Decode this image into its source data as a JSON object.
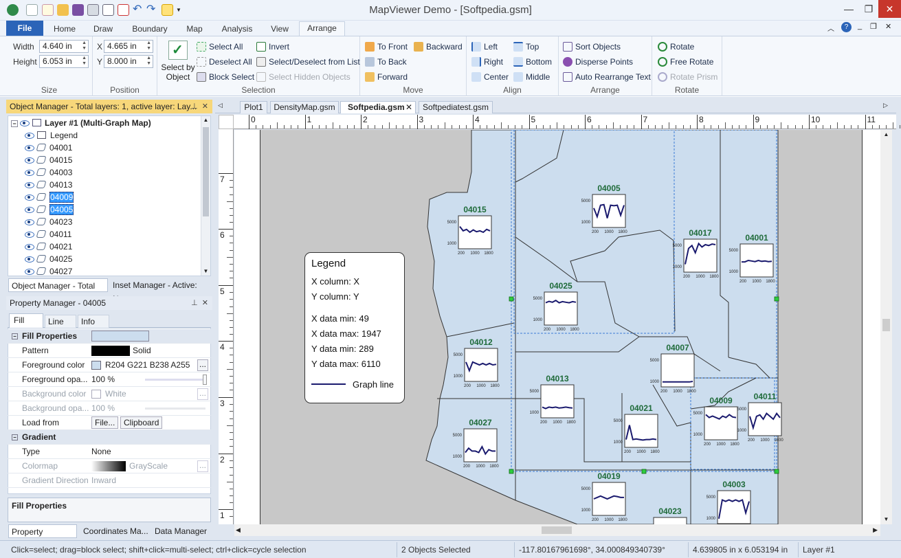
{
  "app": {
    "title": "MapViewer Demo - [Softpedia.gsm]"
  },
  "ribbon_tabs": [
    "File",
    "Home",
    "Draw",
    "Boundary",
    "Map",
    "Analysis",
    "View",
    "Arrange"
  ],
  "size": {
    "label": "Size",
    "width_label": "Width",
    "width": "4.640 in",
    "height_label": "Height",
    "height": "6.053 in"
  },
  "position": {
    "label": "Position",
    "x_label": "X",
    "x": "4.665 in",
    "y_label": "Y",
    "y": "8.000 in"
  },
  "selection": {
    "label": "Selection",
    "select_by_object": "Select by Object",
    "select_all": "Select All",
    "deselect_all": "Deselect All",
    "block_select": "Block Select",
    "invert": "Invert",
    "select_deselect_list": "Select/Deselect from List",
    "select_hidden": "Select Hidden Objects"
  },
  "move": {
    "label": "Move",
    "to_front": "To Front",
    "to_back": "To Back",
    "forward": "Forward",
    "backward": "Backward"
  },
  "align": {
    "label": "Align",
    "left": "Left",
    "right": "Right",
    "center": "Center",
    "top": "Top",
    "bottom": "Bottom",
    "middle": "Middle"
  },
  "arrange": {
    "label": "Arrange",
    "sort_objects": "Sort Objects",
    "disperse_points": "Disperse Points",
    "auto_rearrange": "Auto Rearrange Text"
  },
  "rotate": {
    "label": "Rotate",
    "rotate": "Rotate",
    "free_rotate": "Free Rotate",
    "rotate_prism": "Rotate Prism"
  },
  "object_manager": {
    "title": "Object Manager - Total layers: 1, active layer: Lay...",
    "layer": "Layer #1 (Multi-Graph Map)",
    "items": [
      "Legend",
      "04001",
      "04015",
      "04003",
      "04013",
      "04009",
      "04005",
      "04023",
      "04011",
      "04021",
      "04025",
      "04027"
    ],
    "selected": [
      "04009",
      "04005"
    ],
    "tabs": [
      "Object Manager - Total la...",
      "Inset Manager - Active: N..."
    ]
  },
  "property_manager": {
    "title": "Property Manager - 04005",
    "tabs": [
      "Fill",
      "Line",
      "Info"
    ],
    "fill_properties": "Fill Properties",
    "rows": [
      {
        "k": "Pattern",
        "v": "Solid"
      },
      {
        "k": "Foreground color",
        "v": "R204 G221 B238 A255"
      },
      {
        "k": "Foreground opa...",
        "v": "100 %"
      },
      {
        "k": "Background color",
        "v": "White"
      },
      {
        "k": "Background opa...",
        "v": "100 %"
      },
      {
        "k": "Load from",
        "v1": "File...",
        "v2": "Clipboard"
      }
    ],
    "gradient": "Gradient",
    "grows": [
      {
        "k": "Type",
        "v": "None"
      },
      {
        "k": "Colormap",
        "v": "GrayScale"
      },
      {
        "k": "Gradient Direction",
        "v": "Inward"
      }
    ],
    "desc": "Fill Properties",
    "bottom_tabs": [
      "Property Manage...",
      "Coordinates Ma...",
      "Data Manager"
    ]
  },
  "doc_tabs": [
    "Plot1",
    "DensityMap.gsm",
    "Softpedia.gsm",
    "Softpediatest.gsm"
  ],
  "ruler_top": [
    "0",
    "1",
    "2",
    "3",
    "4",
    "5",
    "6",
    "7",
    "8",
    "9",
    "10",
    "11"
  ],
  "ruler_left": [
    "7",
    "6",
    "5",
    "4",
    "3",
    "2",
    "1"
  ],
  "legend": {
    "title": "Legend",
    "lines": [
      "X column: X",
      "Y column: Y",
      "X data min:  49",
      "X data max: 1947",
      "Y data min:  289",
      "Y data max: 6110"
    ],
    "graph_line": "Graph line"
  },
  "graphs": [
    {
      "id": "04015",
      "y": [
        "5000",
        "1000"
      ],
      "x": [
        "200",
        "1000",
        "1800"
      ],
      "values": [
        0.7,
        0.55,
        0.6,
        0.5,
        0.58,
        0.52,
        0.55,
        0.5,
        0.6,
        0.55
      ]
    },
    {
      "id": "04005",
      "y": [
        "5000",
        "1000"
      ],
      "x": [
        "200",
        "1000",
        "1800"
      ],
      "values": [
        0.6,
        0.3,
        0.7,
        0.72,
        0.25,
        0.7,
        0.68,
        0.7,
        0.35,
        0.7
      ]
    },
    {
      "id": "04017",
      "y": [
        "5000",
        "1000"
      ],
      "x": [
        "200",
        "1000",
        "1800"
      ],
      "values": [
        0.2,
        0.75,
        0.85,
        0.6,
        0.92,
        0.8,
        0.88,
        0.85,
        0.9,
        0.88
      ]
    },
    {
      "id": "04001",
      "y": [
        "5000",
        "1000"
      ],
      "x": [
        "200",
        "1000",
        "1800"
      ],
      "values": [
        0.45,
        0.45,
        0.5,
        0.48,
        0.46,
        0.5,
        0.47,
        0.48,
        0.46,
        0.47
      ]
    },
    {
      "id": "04025",
      "y": [
        "5000",
        "1000"
      ],
      "x": [
        "200",
        "1000",
        "1800"
      ],
      "values": [
        0.7,
        0.75,
        0.72,
        0.78,
        0.7,
        0.74,
        0.72,
        0.7,
        0.74,
        0.72
      ]
    },
    {
      "id": "04012",
      "y": [
        "5000",
        "1000"
      ],
      "x": [
        "200",
        "1000",
        "1800"
      ],
      "values": [
        0.6,
        0.3,
        0.6,
        0.55,
        0.5,
        0.55,
        0.5,
        0.55,
        0.5,
        0.52
      ]
    },
    {
      "id": "04007",
      "y": [
        "5000",
        "1000"
      ],
      "x": [
        "200",
        "1000",
        "1800"
      ],
      "values": [
        0.1,
        0.1,
        0.1,
        0.1,
        0.1,
        0.1,
        0.1,
        0.1,
        0.1,
        0.12
      ]
    },
    {
      "id": "04013",
      "y": [
        "5000",
        "1000"
      ],
      "x": [
        "200",
        "1000",
        "1800"
      ],
      "values": [
        0.3,
        0.25,
        0.3,
        0.28,
        0.3,
        0.27,
        0.28,
        0.3,
        0.28,
        0.27
      ]
    },
    {
      "id": "04009",
      "y": [
        "5000",
        "1000"
      ],
      "x": [
        "200",
        "1000",
        "1800"
      ],
      "values": [
        0.8,
        0.7,
        0.75,
        0.7,
        0.65,
        0.75,
        0.7,
        0.8,
        0.72,
        0.7
      ]
    },
    {
      "id": "04011",
      "y": [
        "5000",
        "1000"
      ],
      "x": [
        "200",
        "1000",
        "1800"
      ],
      "values": [
        0.6,
        0.2,
        0.6,
        0.65,
        0.5,
        0.7,
        0.6,
        0.5,
        0.7,
        0.55
      ]
    },
    {
      "id": "04021",
      "y": [
        "5000",
        "1000"
      ],
      "x": [
        "200",
        "1000",
        "1800"
      ],
      "values": [
        0.2,
        0.7,
        0.2,
        0.22,
        0.2,
        0.18,
        0.2,
        0.2,
        0.22,
        0.2
      ]
    },
    {
      "id": "04027",
      "y": [
        "5000",
        "1000"
      ],
      "x": [
        "200",
        "1000",
        "1800"
      ],
      "values": [
        0.25,
        0.4,
        0.3,
        0.3,
        0.25,
        0.45,
        0.2,
        0.35,
        0.3,
        0.3
      ]
    },
    {
      "id": "04019",
      "y": [
        "5000",
        "1000"
      ],
      "x": [
        "200",
        "1000",
        "1800"
      ],
      "values": [
        0.5,
        0.55,
        0.6,
        0.55,
        0.5,
        0.55,
        0.6,
        0.58,
        0.55,
        0.55
      ]
    },
    {
      "id": "04003",
      "y": [
        "5000",
        "1000"
      ],
      "x": [
        "200",
        "1000",
        "1800"
      ],
      "values": [
        0.1,
        0.75,
        0.7,
        0.75,
        0.7,
        0.75,
        0.7,
        0.75,
        0.3,
        0.7
      ]
    },
    {
      "id": "04023",
      "y": [],
      "x": [],
      "values": []
    }
  ],
  "status": {
    "hint": "Click=select; drag=block select; shift+click=multi-select; ctrl+click=cycle selection",
    "selected": "2 Objects Selected",
    "coords": "-117.80167961698°, 34.000849340739°",
    "size": "4.639805 in x 6.053194 in",
    "layer": "Layer #1"
  },
  "colors": {
    "accent": "#2b64b8",
    "state_fill": "#ccddee",
    "graph_line": "#1a1a6e",
    "label": "#1f6b3a"
  }
}
